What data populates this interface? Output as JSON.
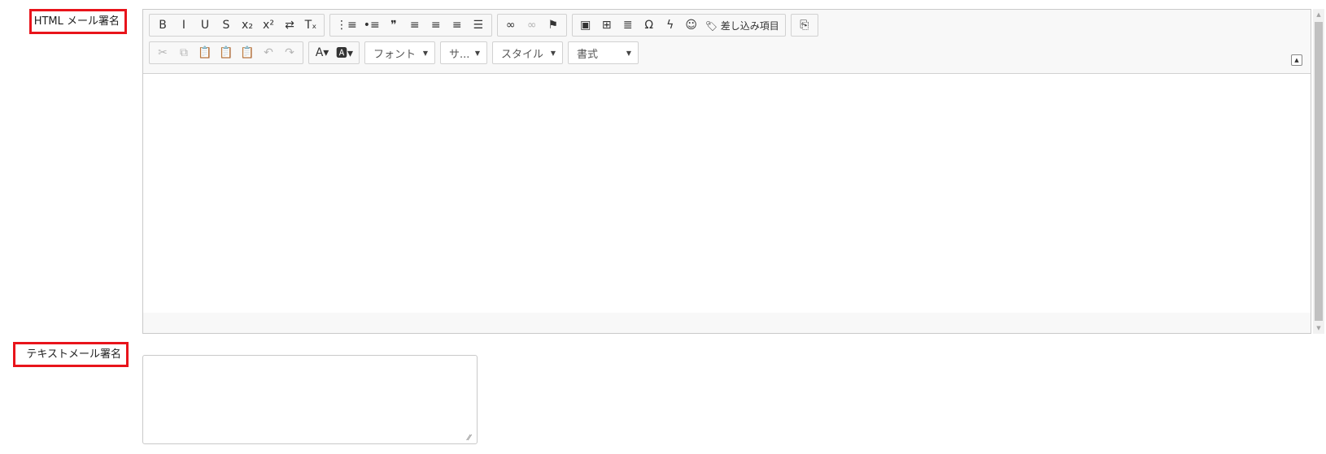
{
  "fields": {
    "html_signature_label": "HTML メール署名",
    "text_signature_label": "テキストメール署名"
  },
  "toolbar": {
    "row1": [
      [
        {
          "name": "bold-button",
          "glyph": "B",
          "icon": "bold-icon",
          "disabled": false
        },
        {
          "name": "italic-button",
          "glyph": "I",
          "icon": "italic-icon",
          "disabled": false
        },
        {
          "name": "underline-button",
          "glyph": "U",
          "icon": "underline-icon",
          "disabled": false
        },
        {
          "name": "strikethrough-button",
          "glyph": "S",
          "icon": "strikethrough-icon",
          "disabled": false
        },
        {
          "name": "subscript-button",
          "glyph": "x₂",
          "icon": "subscript-icon",
          "disabled": false
        },
        {
          "name": "superscript-button",
          "glyph": "x²",
          "icon": "superscript-icon",
          "disabled": false
        },
        {
          "name": "indent-button",
          "glyph": "⇄",
          "icon": "indent-icon",
          "disabled": false
        },
        {
          "name": "remove-format-button",
          "glyph": "Tₓ",
          "icon": "remove-format-icon",
          "disabled": false
        }
      ],
      [
        {
          "name": "numbered-list-button",
          "glyph": "⋮≡",
          "icon": "numbered-list-icon",
          "disabled": false
        },
        {
          "name": "bulleted-list-button",
          "glyph": "•≡",
          "icon": "bulleted-list-icon",
          "disabled": false
        },
        {
          "name": "blockquote-button",
          "glyph": "❞",
          "icon": "quote-icon",
          "disabled": false
        },
        {
          "name": "align-left-button",
          "glyph": "≡",
          "icon": "align-left-icon",
          "disabled": false
        },
        {
          "name": "align-center-button",
          "glyph": "≡",
          "icon": "align-center-icon",
          "disabled": false
        },
        {
          "name": "align-right-button",
          "glyph": "≡",
          "icon": "align-right-icon",
          "disabled": false
        },
        {
          "name": "justify-button",
          "glyph": "☰",
          "icon": "justify-icon",
          "disabled": false
        }
      ],
      [
        {
          "name": "link-button",
          "glyph": "∞",
          "icon": "link-icon",
          "disabled": false
        },
        {
          "name": "unlink-button",
          "glyph": "∞",
          "icon": "unlink-icon",
          "disabled": true
        },
        {
          "name": "anchor-button",
          "glyph": "⚑",
          "icon": "flag-icon",
          "disabled": false
        }
      ],
      [
        {
          "name": "image-button",
          "glyph": "▣",
          "icon": "image-icon",
          "disabled": false
        },
        {
          "name": "table-button",
          "glyph": "⊞",
          "icon": "table-icon",
          "disabled": false
        },
        {
          "name": "horizontal-line-button",
          "glyph": "≣",
          "icon": "horizontal-line-icon",
          "disabled": false
        },
        {
          "name": "special-char-button",
          "glyph": "Ω",
          "icon": "omega-icon",
          "disabled": false
        },
        {
          "name": "flash-button",
          "glyph": "ϟ",
          "icon": "lightning-icon",
          "disabled": false
        },
        {
          "name": "emoji-button",
          "glyph": "☺",
          "icon": "smiley-icon",
          "disabled": false
        },
        {
          "name": "merge-field-button",
          "glyph": "🏷 差し込み項目",
          "icon": "tag-icon",
          "disabled": false
        }
      ],
      [
        {
          "name": "source-button",
          "glyph": "⎘",
          "icon": "source-icon",
          "disabled": false
        }
      ]
    ],
    "row2_group1": [
      {
        "name": "cut-button",
        "glyph": "✂",
        "icon": "cut-icon",
        "disabled": true
      },
      {
        "name": "copy-button",
        "glyph": "⧉",
        "icon": "copy-icon",
        "disabled": true
      },
      {
        "name": "paste-button",
        "glyph": "📋",
        "icon": "paste-icon",
        "disabled": false
      },
      {
        "name": "paste-text-button",
        "glyph": "📋",
        "icon": "paste-text-icon",
        "disabled": false
      },
      {
        "name": "paste-word-button",
        "glyph": "📋",
        "icon": "paste-word-icon",
        "disabled": false
      },
      {
        "name": "undo-button",
        "glyph": "↶",
        "icon": "undo-icon",
        "disabled": true
      },
      {
        "name": "redo-button",
        "glyph": "↷",
        "icon": "redo-icon",
        "disabled": true
      }
    ],
    "row2_group2": [
      {
        "name": "text-color-button",
        "glyph": "A▾",
        "icon": "text-color-icon",
        "disabled": false
      },
      {
        "name": "bg-color-button",
        "glyph": "🅰▾",
        "icon": "bg-color-icon",
        "disabled": false
      }
    ],
    "combos": [
      {
        "name": "font-combo",
        "label": "フォント",
        "width": 87
      },
      {
        "name": "size-combo",
        "label": "サ...",
        "width": 58
      },
      {
        "name": "style-combo",
        "label": "スタイル",
        "width": 87
      },
      {
        "name": "format-combo",
        "label": "書式",
        "width": 87
      }
    ]
  }
}
